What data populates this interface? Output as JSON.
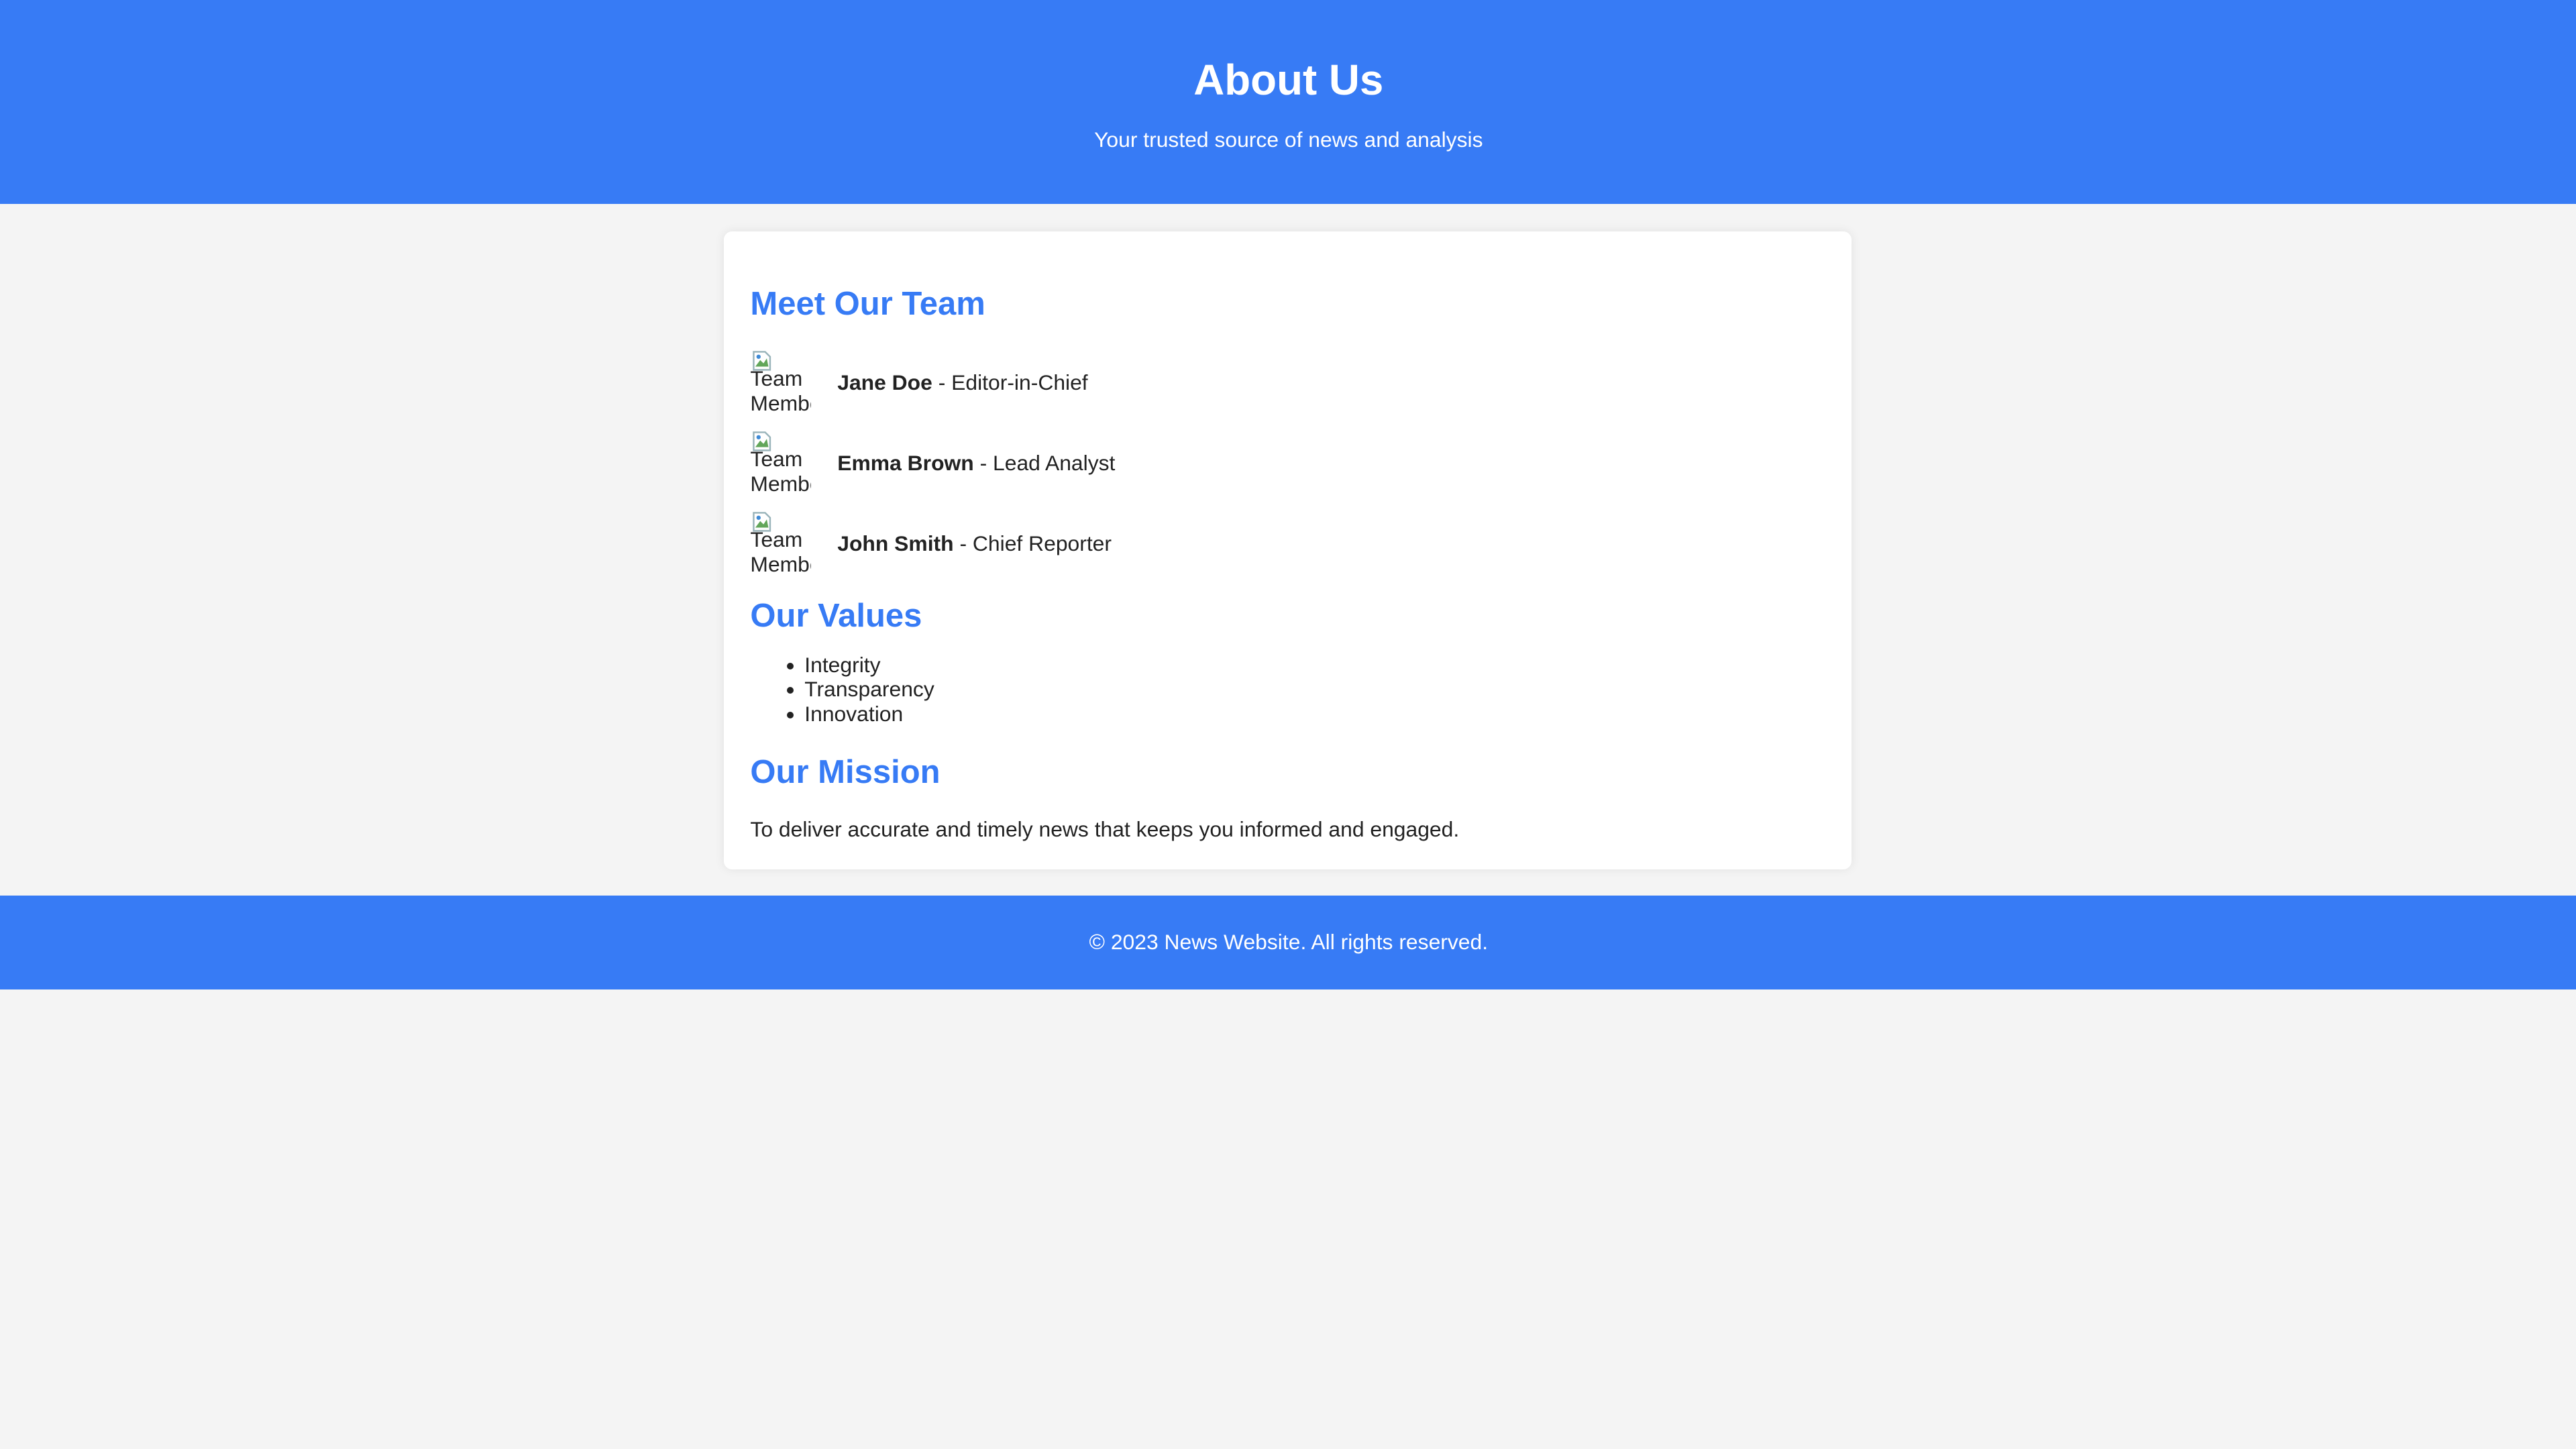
{
  "header": {
    "title": "About Us",
    "subtitle": "Your trusted source of news and analysis"
  },
  "team": {
    "title": "Meet Our Team",
    "avatar_alt": "Team Member",
    "members": [
      {
        "name": "Jane Doe",
        "role": " - Editor-in-Chief"
      },
      {
        "name": "Emma Brown",
        "role": " - Lead Analyst"
      },
      {
        "name": "John Smith",
        "role": " - Chief Reporter"
      }
    ]
  },
  "values": {
    "title": "Our Values",
    "items": [
      "Integrity",
      "Transparency",
      "Innovation"
    ]
  },
  "mission": {
    "title": "Our Mission",
    "text": "To deliver accurate and timely news that keeps you informed and engaged."
  },
  "footer": {
    "text": "© 2023 News Website. All rights reserved."
  },
  "colors": {
    "accent": "#377bf5",
    "page_background": "#f4f4f4",
    "card_background": "#ffffff"
  }
}
